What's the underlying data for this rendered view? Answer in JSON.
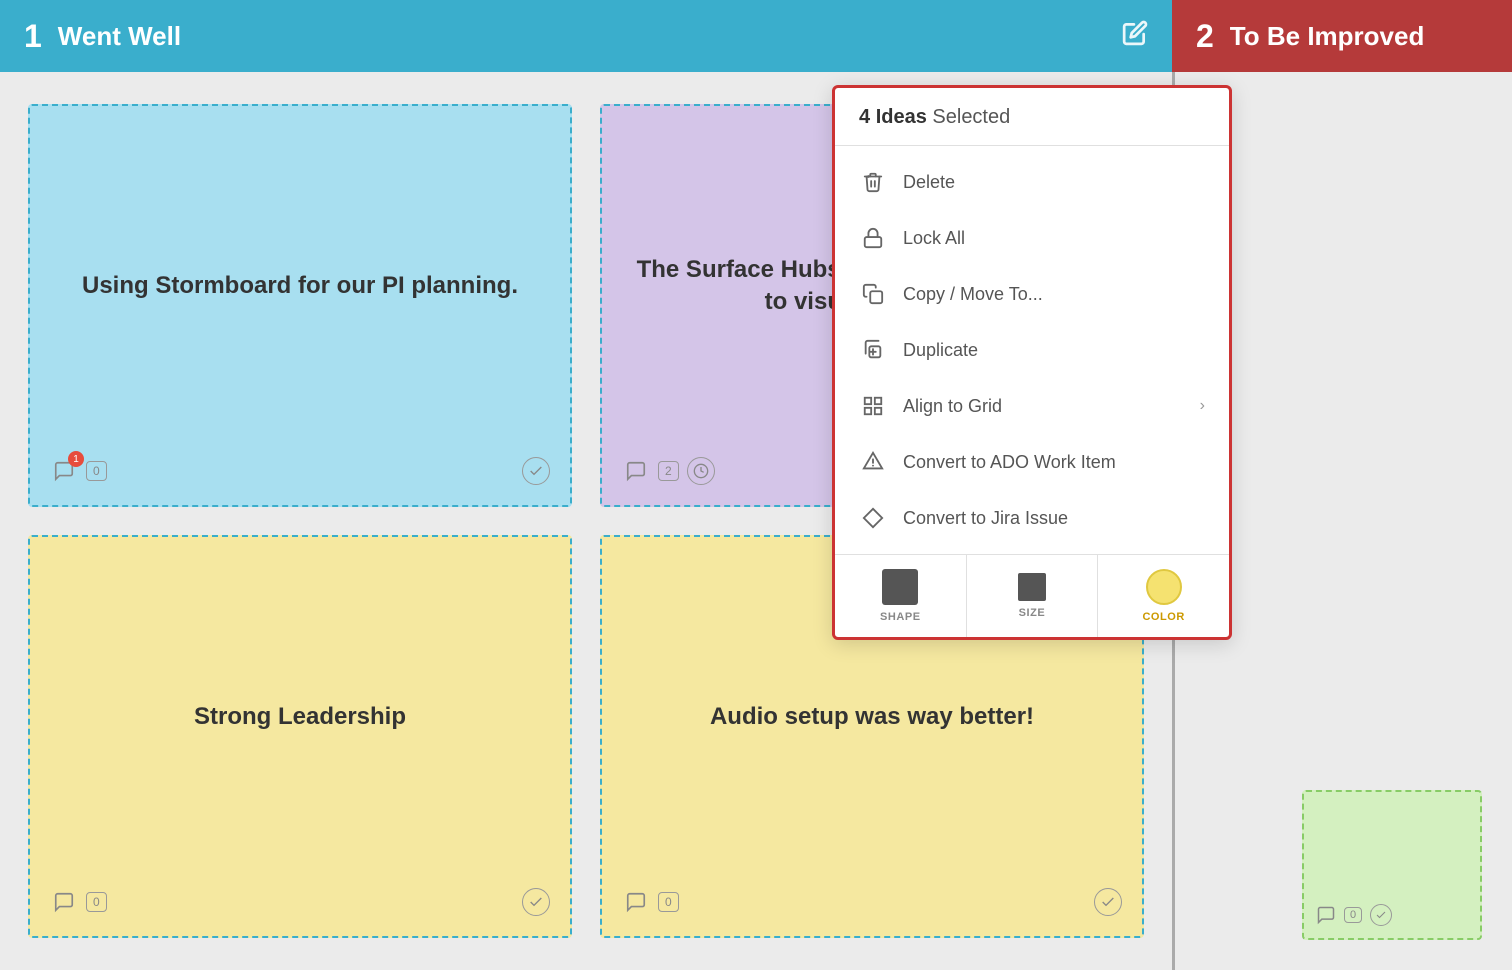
{
  "columns": {
    "col1": {
      "number": "1",
      "title": "Went Well",
      "header_color": "#3aaecc"
    },
    "col2": {
      "number": "2",
      "title": "To Be Improved",
      "header_color": "#b53a3a"
    }
  },
  "cards": [
    {
      "id": "card1",
      "text": "Using Stormboard for our PI planning.",
      "color": "blue",
      "selected": true,
      "comment_count": "1",
      "vote_count": "0",
      "has_timer": false
    },
    {
      "id": "card2",
      "text": "The Surface Hubs at the event were great to visualize things.",
      "color": "purple",
      "selected": true,
      "comment_count": "2",
      "vote_count": "0",
      "has_timer": true
    },
    {
      "id": "card3",
      "text": "Strong Leadership",
      "color": "yellow",
      "selected": true,
      "comment_count": "0",
      "vote_count": "0",
      "has_timer": false
    },
    {
      "id": "card4",
      "text": "Audio setup was way better!",
      "color": "yellow",
      "selected": true,
      "comment_count": "0",
      "vote_count": "0",
      "has_timer": false
    }
  ],
  "context_menu": {
    "header": {
      "count": "4",
      "bold_text": "Ideas",
      "rest_text": "Selected"
    },
    "items": [
      {
        "id": "delete",
        "label": "Delete",
        "icon": "trash",
        "has_arrow": false
      },
      {
        "id": "lock-all",
        "label": "Lock All",
        "icon": "lock",
        "has_arrow": false
      },
      {
        "id": "copy-move",
        "label": "Copy / Move To...",
        "icon": "copy",
        "has_arrow": false
      },
      {
        "id": "duplicate",
        "label": "Duplicate",
        "icon": "duplicate",
        "has_arrow": false
      },
      {
        "id": "align-grid",
        "label": "Align to Grid",
        "icon": "grid",
        "has_arrow": true
      },
      {
        "id": "convert-ado",
        "label": "Convert to ADO Work Item",
        "icon": "ado",
        "has_arrow": false
      },
      {
        "id": "convert-jira",
        "label": "Convert to Jira Issue",
        "icon": "jira",
        "has_arrow": false
      }
    ],
    "footer": {
      "shape_label": "SHAPE",
      "size_label": "SIZE",
      "color_label": "COLOR"
    }
  }
}
